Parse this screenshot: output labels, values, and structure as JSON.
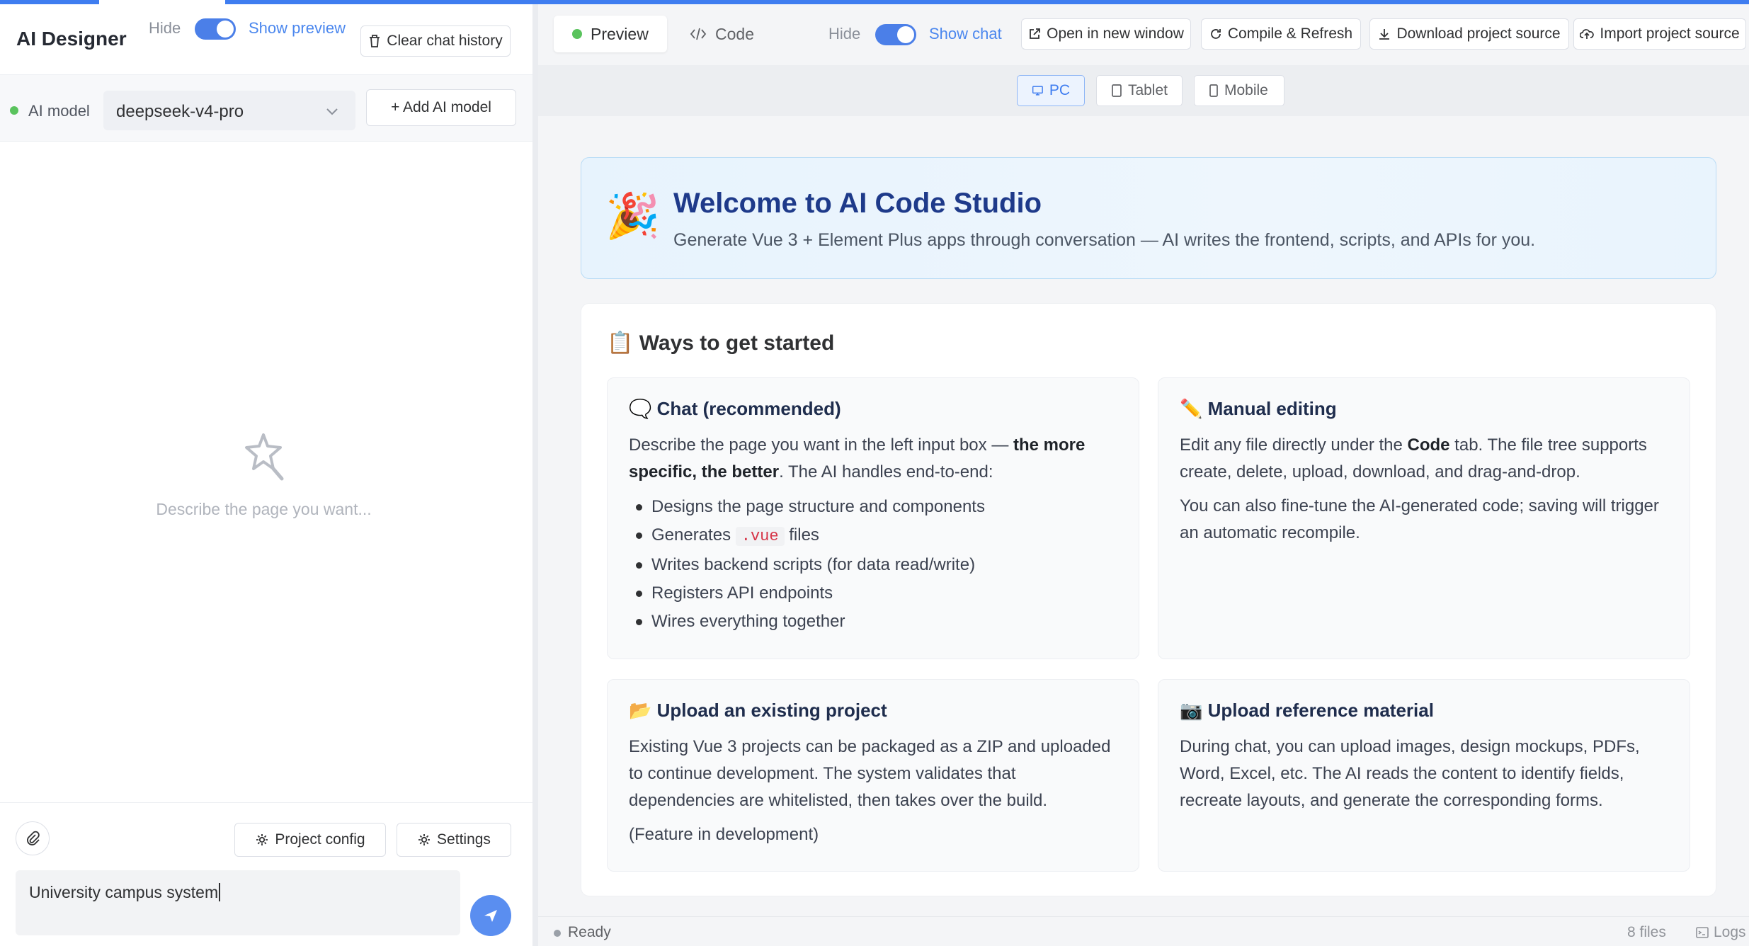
{
  "designer": {
    "title": "AI Designer",
    "hide_label": "Hide",
    "show_preview_label": "Show preview",
    "clear_history_label": "Clear chat history",
    "model_label": "AI model",
    "model_value": "deepseek-v4-pro",
    "add_model_label": "+ Add AI model",
    "empty_text": "Describe the page you want...",
    "project_config_label": "Project config",
    "settings_label": "Settings",
    "input_value": "University campus system"
  },
  "preview": {
    "tabs": [
      {
        "label": "Preview",
        "active": true
      },
      {
        "label": "Code",
        "active": false
      }
    ],
    "hide_label": "Hide",
    "show_chat_label": "Show chat",
    "toolbar": {
      "open_window": "Open in new window",
      "compile_refresh": "Compile & Refresh",
      "download": "Download project source",
      "import": "Import project source"
    },
    "devices": [
      {
        "label": "PC",
        "active": true
      },
      {
        "label": "Tablet",
        "active": false
      },
      {
        "label": "Mobile",
        "active": false
      }
    ]
  },
  "welcome": {
    "emoji": "🎉",
    "title": "Welcome to AI Code Studio",
    "subtitle": "Generate Vue 3 + Element Plus apps through conversation — AI writes the frontend, scripts, and APIs for you."
  },
  "ways": {
    "title": "📋 Ways to get started",
    "chat": {
      "title": "🗨️ Chat (recommended)",
      "intro_a": "Describe the page you want in the left input box — ",
      "intro_bold": "the more specific, the better",
      "intro_b": ". The AI handles end-to-end:",
      "items": [
        "Designs the page structure and components",
        "Generates",
        "Writes backend scripts (for data read/write)",
        "Registers API endpoints",
        "Wires everything together"
      ],
      "code_token": ".vue",
      "files_word": "files"
    },
    "manual": {
      "title": "✏️ Manual editing",
      "p1_a": "Edit any file directly under the ",
      "p1_bold": "Code",
      "p1_b": " tab. The file tree supports create, delete, upload, download, and drag-and-drop.",
      "p2": "You can also fine-tune the AI-generated code; saving will trigger an automatic recompile."
    },
    "upload_project": {
      "title": "📂 Upload an existing project",
      "p1": "Existing Vue 3 projects can be packaged as a ZIP and uploaded to continue development. The system validates that dependencies are whitelisted, then takes over the build.",
      "p2": "(Feature in development)"
    },
    "upload_reference": {
      "title": "📷 Upload reference material",
      "p1": "During chat, you can upload images, design mockups, PDFs, Word, Excel, etc. The AI reads the content to identify fields, recreate layouts, and generate the corresponding forms."
    }
  },
  "status": {
    "state": "Ready",
    "files": "8 files",
    "logs": "Logs"
  },
  "colors": {
    "accent": "#3f7df0",
    "status_ok": "#5ac35d",
    "title_navy": "#1e3a8a"
  }
}
